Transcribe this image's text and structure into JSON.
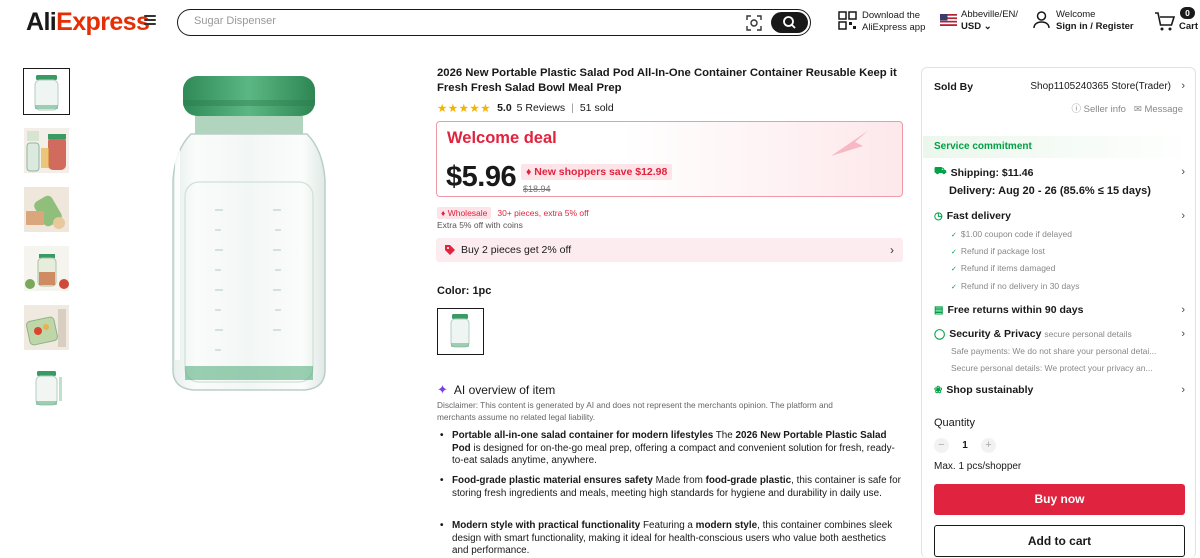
{
  "header": {
    "logo_text": "AliExpress",
    "search_placeholder": "Sugar Dispenser",
    "download_line1": "Download the",
    "download_line2": "AliExpress app",
    "locale_line1": "Abbeville/EN/",
    "locale_line2": "USD",
    "account_line1": "Welcome",
    "account_line2": "Sign in / Register",
    "cart_count": "0",
    "cart_label": "Cart"
  },
  "product": {
    "title": "2026 New Portable Plastic Salad Pod All-In-One Container Container Reusable Keep it Fresh Fresh Salad Bowl Meal Prep",
    "rating": 5.0,
    "rating_text": "5.0",
    "reviews": "5 Reviews",
    "sold": "51 sold",
    "thumbnail_count": 6
  },
  "deal": {
    "banner": "Welcome deal",
    "price": "$5.96",
    "new_shoppers": "New shoppers save $12.98",
    "original_price": "$18.94",
    "wholesale_tag": "Wholesale",
    "wholesale_text": "30+ pieces, extra 5% off",
    "coins_text": "Extra 5% off with coins",
    "bundle_text": "Buy 2 pieces get 2% off"
  },
  "variant": {
    "color_label": "Color: 1pc"
  },
  "ai": {
    "heading": "AI overview of item",
    "disclaimer": "Disclaimer: This content is generated by AI and does not represent the merchants opinion. The platform and merchants assume no related legal liability.",
    "bullets": [
      {
        "bold": "Portable all-in-one salad container for modern lifestyles",
        "text": " The ",
        "bold2": "2026 New Portable Plastic Salad Pod",
        "text2": " is designed for on-the-go meal prep, offering a compact and convenient solution for fresh, ready-to-eat salads anytime, anywhere."
      },
      {
        "bold": "Food-grade plastic material ensures safety",
        "text": " Made from ",
        "bold2": "food-grade plastic",
        "text2": ", this container is safe for storing fresh ingredients and meals, meeting high standards for hygiene and durability in daily use."
      },
      {
        "bold": "Modern style with practical functionality",
        "text": " Featuring a ",
        "bold2": "modern style",
        "text2": ", this container combines sleek design with smart functionality, making it ideal for health-conscious users who value both aesthetics and performance."
      }
    ]
  },
  "seller": {
    "sold_by_label": "Sold By",
    "store_name": "Shop1105240365 Store(Trader)",
    "seller_info": "Seller info",
    "message": "Message"
  },
  "service": {
    "title": "Service commitment",
    "shipping": "Shipping: $11.46",
    "delivery": "Delivery: Aug 20 - 26 (85.6% ≤ 15 days)",
    "fast_delivery": "Fast delivery",
    "fast_items": [
      "$1.00 coupon code if delayed",
      "Refund if package lost",
      "Refund if items damaged",
      "Refund if no delivery in 30 days"
    ],
    "free_returns": "Free returns within 90 days",
    "security": "Security & Privacy",
    "security_sub": "secure personal details",
    "safe_payments": "Safe payments: We do not share your personal detai...",
    "secure_details": "Secure personal details: We protect your privacy an...",
    "sustainably": "Shop sustainably"
  },
  "purchase": {
    "quantity_label": "Quantity",
    "quantity": "1",
    "max_text": "Max. 1 pcs/shopper",
    "buy_now": "Buy now",
    "add_to_cart": "Add to cart"
  },
  "colors": {
    "accent_red": "#e0233e",
    "green": "#00a045",
    "star": "#f5b301"
  }
}
